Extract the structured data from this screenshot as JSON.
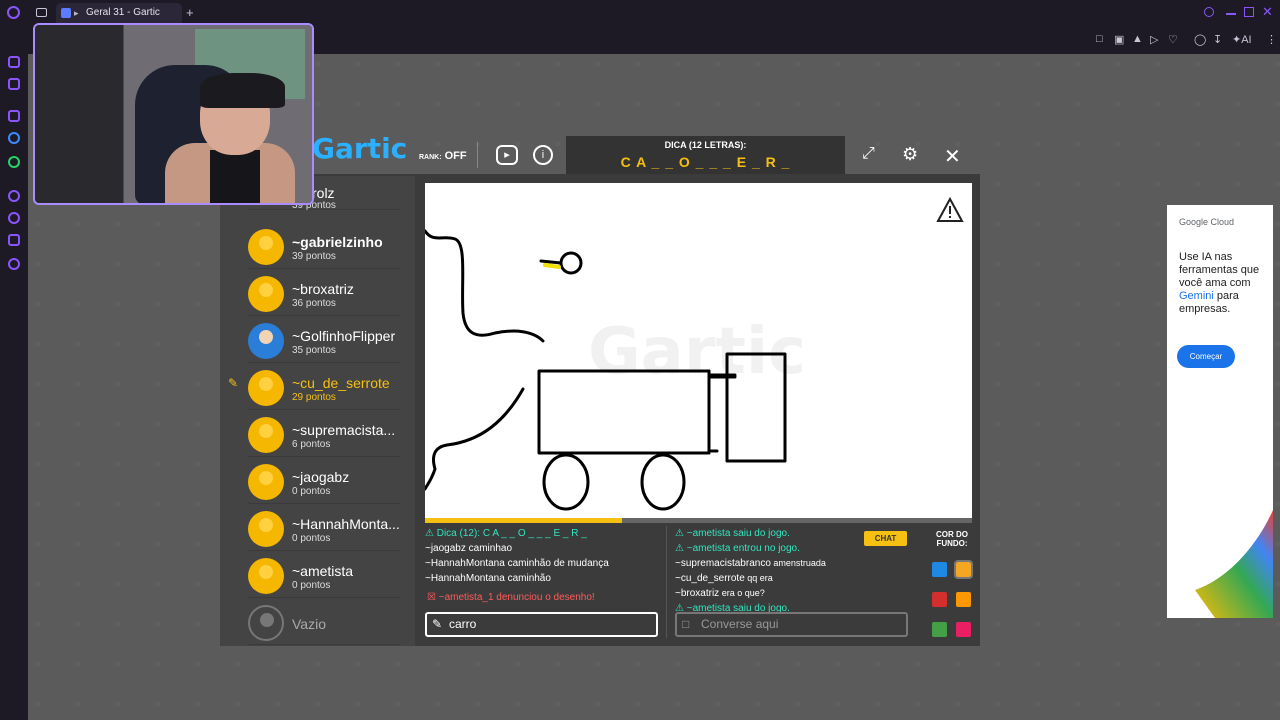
{
  "browser": {
    "tab_title": "Geral 31 - Gartic",
    "new_tab": "+",
    "toolbar_ai": "AI"
  },
  "game": {
    "logo": "Gartic",
    "rank_label": "RANK:",
    "rank_value": "OFF",
    "hint_label": "DICA (12 LETRAS):",
    "hint_word": "C A _ _ O   _ _ _ E _ R _"
  },
  "players": [
    {
      "name": "~lucasrolz",
      "visible_name": "rolz",
      "points": "39 pontos",
      "bold": false
    },
    {
      "name": "~gabrielzinho",
      "points": "39 pontos",
      "bold": true
    },
    {
      "name": "~broxatriz",
      "points": "36 pontos"
    },
    {
      "name": "~GolfinhoFlipper",
      "points": "35 pontos"
    },
    {
      "name": "~cu_de_serrote",
      "points": "29 pontos",
      "drawer": true
    },
    {
      "name": "~supremacista...",
      "points": "6 pontos"
    },
    {
      "name": "~jaogabz",
      "points": "0 pontos"
    },
    {
      "name": "~HannahMonta...",
      "points": "0 pontos"
    },
    {
      "name": "~ametista",
      "points": "0 pontos"
    },
    {
      "name": "Vazio",
      "points": ""
    }
  ],
  "answers": [
    {
      "type": "hint",
      "text": "⚠ Dica (12): C A _ _ O   _ _ _ E _ R _"
    },
    {
      "type": "normal",
      "user": "~jaogabz",
      "text": " caminhao"
    },
    {
      "type": "normal",
      "user": "~HannahMontana",
      "text": " caminhão de mudança"
    },
    {
      "type": "normal",
      "user": "~HannahMontana",
      "text": " caminhão"
    },
    {
      "type": "warn",
      "text": "☒ ~ametista_1 denunciou o desenho!"
    }
  ],
  "answer_input_value": "carro",
  "chat": {
    "tag": "CHAT",
    "messages": [
      {
        "type": "sys",
        "text": "⚠ ~ametista saiu do jogo."
      },
      {
        "type": "sys",
        "text": "⚠ ~ametista entrou no jogo."
      },
      {
        "type": "msg",
        "user": "~supremacistabranco",
        "text": " amenstruada"
      },
      {
        "type": "msg",
        "user": "~cu_de_serrote",
        "text": " qq era"
      },
      {
        "type": "msg",
        "user": "~broxatriz",
        "text": " era o que?"
      },
      {
        "type": "sys",
        "text": "⚠ ~ametista saiu do jogo."
      }
    ],
    "placeholder": "Converse aqui"
  },
  "background_colors": {
    "label": "COR DO FUNDO:",
    "swatches": [
      "#1e88e5",
      "#f5a623",
      "#d32f2f",
      "#ff9800",
      "#43a047",
      "#e91e63"
    ]
  },
  "ad": {
    "brand": "Google Cloud",
    "text_a": "Use IA nas ferramentas que você ama com ",
    "text_gem": "Gemini",
    "text_b": " para empresas.",
    "cta": "Começar"
  },
  "colors": {
    "accent": "#f6c012",
    "hint_cyan": "#2fe6c0",
    "browser_purple": "#8a55ff"
  }
}
